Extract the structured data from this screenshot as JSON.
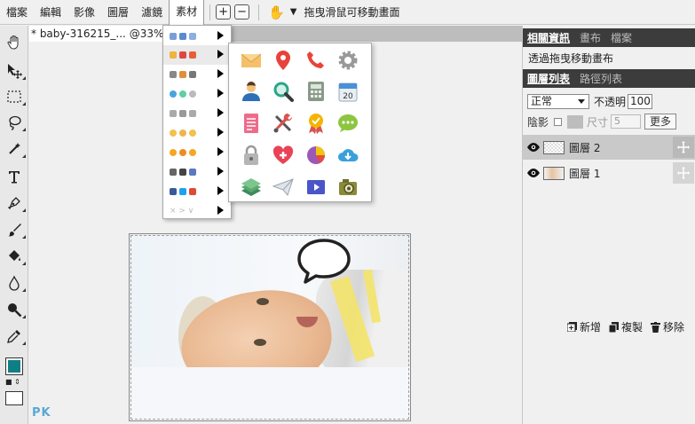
{
  "menubar": {
    "items": [
      "檔案",
      "編輯",
      "影像",
      "圖層",
      "濾鏡",
      "素材"
    ],
    "hint": "拖曳滑鼠可移動畫面"
  },
  "document": {
    "tab_title": "* baby-316215_... @33%"
  },
  "canvas": {
    "watermark": "PK"
  },
  "colors": {
    "foreground": "#0f7f86",
    "background": "#ffffff"
  },
  "material_menu": {
    "category_icons": [
      "emoji-set",
      "office-icons",
      "bubbles",
      "people",
      "faces",
      "smileys",
      "misc",
      "social",
      "arrows"
    ],
    "submenu_icons": [
      "mail-icon",
      "map-pin-icon",
      "phone-icon",
      "gear-icon",
      "user-icon",
      "search-icon",
      "calculator-icon",
      "calendar-icon",
      "document-icon",
      "tools-icon",
      "badge-icon",
      "chat-icon",
      "lock-icon",
      "heart-plus-icon",
      "pie-chart-icon",
      "cloud-download-icon",
      "layers-icon",
      "paper-plane-icon",
      "video-icon",
      "camera-icon"
    ],
    "calendar_day": "20"
  },
  "right_panel": {
    "info_tabs": [
      "相關資訊",
      "畫布",
      "檔案"
    ],
    "info_text": "透過拖曳移動畫布",
    "layer_tabs": [
      "圖層列表",
      "路徑列表"
    ],
    "blend_mode": "正常",
    "opacity_label": "不透明",
    "opacity_value": "100",
    "shadow_label": "陰影",
    "size_label": "尺寸",
    "size_value": "5",
    "more_label": "更多",
    "layers": [
      {
        "name": "圖層 2",
        "selected": true
      },
      {
        "name": "圖層 1",
        "selected": false
      }
    ],
    "actions": {
      "new": "新增",
      "duplicate": "複製",
      "remove": "移除"
    }
  }
}
